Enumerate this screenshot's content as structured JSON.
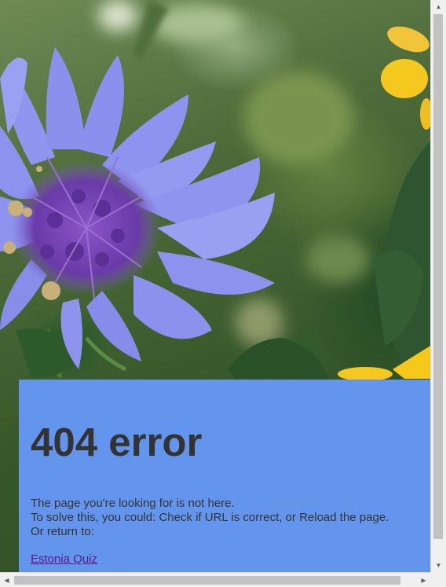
{
  "error": {
    "title": "404 error",
    "line1": "The page you're looking for is not here.",
    "line2": "To solve this, you could: Check if URL is correct, or Reload the page.",
    "line3": "Or return to:",
    "link_label": "Estonia Quiz"
  },
  "colors": {
    "panel_background": "#6495ed",
    "text": "#333333",
    "link_visited": "#551a8b"
  },
  "icons": {
    "scroll_up": "up-arrow-icon",
    "scroll_down": "down-arrow-icon",
    "scroll_left": "left-arrow-icon",
    "scroll_right": "right-arrow-icon"
  }
}
